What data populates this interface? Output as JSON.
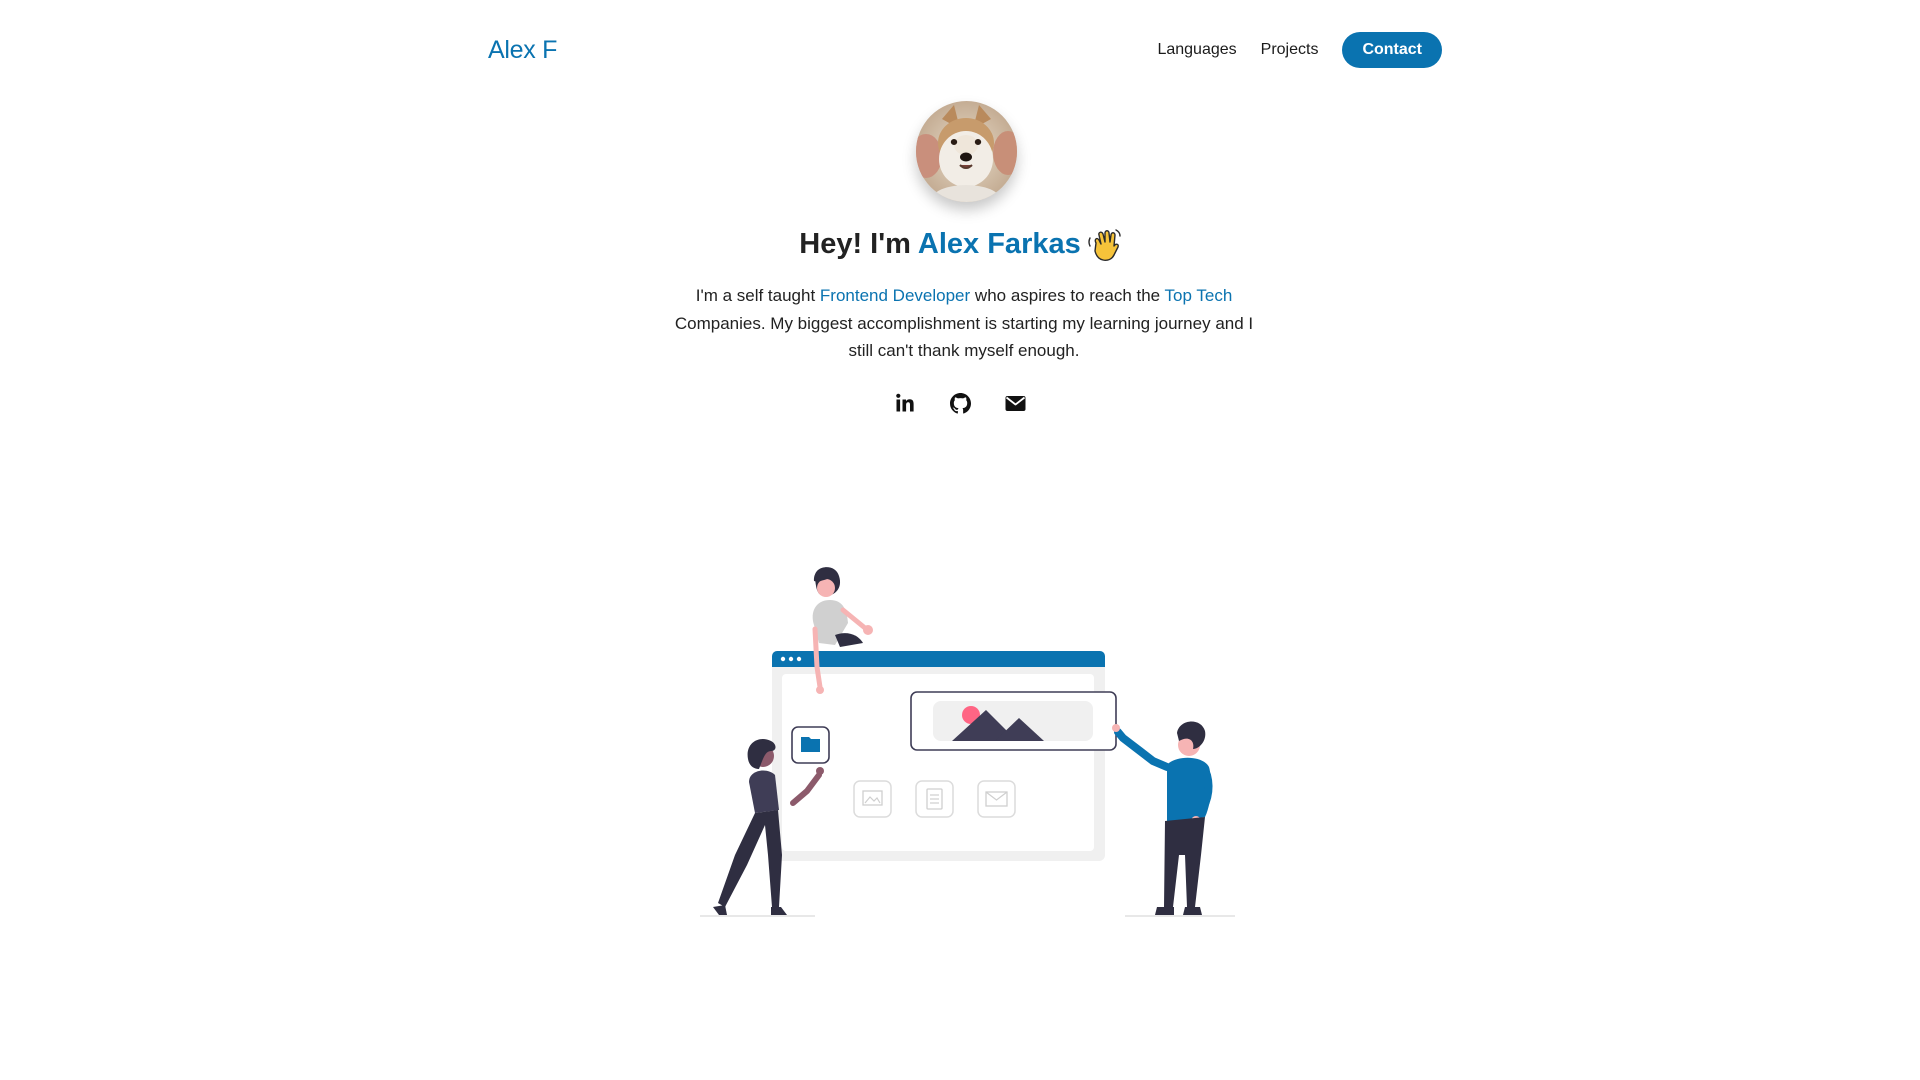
{
  "header": {
    "logo_text": "Alex F",
    "nav": {
      "languages_label": "Languages",
      "projects_label": "Projects",
      "contact_label": "Contact"
    }
  },
  "hero": {
    "title_prefix": "Hey! I'm ",
    "title_name": "Alex Farkas",
    "wave_icon": "waving-hand-icon",
    "intro": {
      "part1": "I'm a self taught ",
      "highlight1": "Frontend Developer",
      "part2": " who aspires to reach the ",
      "highlight2": "Top Tech",
      "part3": " Companies. My biggest accomplishment is starting my learning journey and I still can't thank myself enough."
    },
    "socials": [
      {
        "icon": "linkedin-icon"
      },
      {
        "icon": "github-icon"
      },
      {
        "icon": "email-icon"
      }
    ]
  },
  "colors": {
    "accent": "#0a73b0",
    "text": "#222222",
    "background": "#ffffff"
  }
}
